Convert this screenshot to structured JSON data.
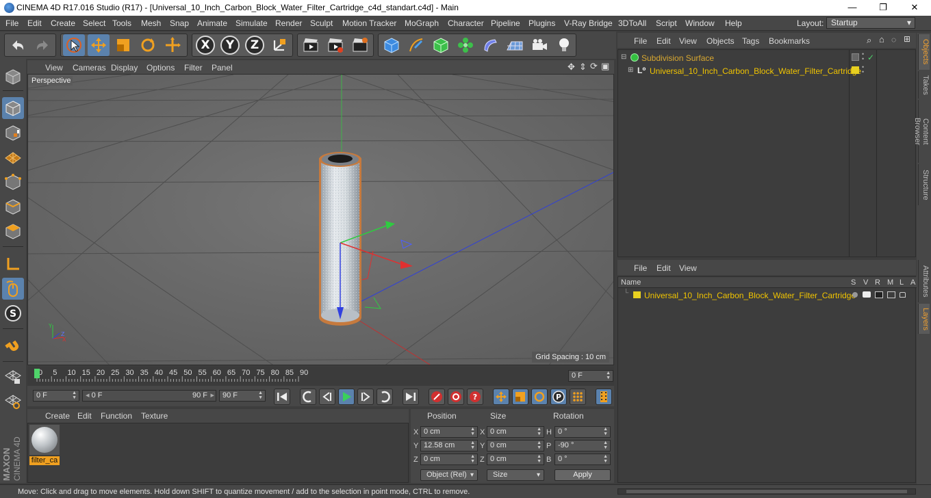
{
  "window": {
    "title": "CINEMA 4D R17.016 Studio (R17) - [Universal_10_Inch_Carbon_Block_Water_Filter_Cartridge_c4d_standart.c4d] - Main"
  },
  "menu": [
    "File",
    "Edit",
    "Create",
    "Select",
    "Tools",
    "Mesh",
    "Snap",
    "Animate",
    "Simulate",
    "Render",
    "Sculpt",
    "Motion Tracker",
    "MoGraph",
    "Character",
    "Pipeline",
    "Plugins",
    "V-Ray Bridge",
    "3DToAll",
    "Script",
    "Window",
    "Help"
  ],
  "layout": {
    "label": "Layout:",
    "value": "Startup"
  },
  "toolbar": {
    "axes": [
      "X",
      "Y",
      "Z"
    ]
  },
  "viewport": {
    "menu": [
      "View",
      "Cameras",
      "Display",
      "Options",
      "Filter",
      "Panel"
    ],
    "label": "Perspective",
    "grid_spacing": "Grid Spacing : 10 cm"
  },
  "timeline": {
    "ticks": [
      "0",
      "5",
      "10",
      "15",
      "20",
      "25",
      "30",
      "35",
      "40",
      "45",
      "50",
      "55",
      "60",
      "65",
      "70",
      "75",
      "80",
      "85",
      "90"
    ],
    "current_frame": "0 F",
    "start": "0 F",
    "range_start": "0 F",
    "range_end": "90 F",
    "end": "90 F"
  },
  "material_manager": {
    "menu": [
      "Create",
      "Edit",
      "Function",
      "Texture"
    ],
    "materials": [
      {
        "name": "filter_ca"
      }
    ]
  },
  "coordinates": {
    "headers": {
      "position": "Position",
      "size": "Size",
      "rotation": "Rotation"
    },
    "rows": [
      {
        "axis": "X",
        "pos": "0 cm",
        "size_axis": "X",
        "size": "0 cm",
        "rot_axis": "H",
        "rot": "0 °"
      },
      {
        "axis": "Y",
        "pos": "12.58 cm",
        "size_axis": "Y",
        "size": "0 cm",
        "rot_axis": "P",
        "rot": "-90 °"
      },
      {
        "axis": "Z",
        "pos": "0 cm",
        "size_axis": "Z",
        "size": "0 cm",
        "rot_axis": "B",
        "rot": "0 °"
      }
    ],
    "mode": "Object (Rel)",
    "size_mode": "Size",
    "apply": "Apply"
  },
  "object_manager": {
    "menu": [
      "File",
      "Edit",
      "View",
      "Objects",
      "Tags",
      "Bookmarks"
    ],
    "objects": [
      {
        "name": "Subdivision Surface",
        "color": "#d9a830"
      },
      {
        "name": "Universal_10_Inch_Carbon_Block_Water_Filter_Cartridge",
        "color": "#f2c500"
      }
    ]
  },
  "layer_manager": {
    "menu": [
      "File",
      "Edit",
      "View"
    ],
    "columns": [
      "Name",
      "S",
      "V",
      "R",
      "M",
      "L",
      "A"
    ],
    "layers": [
      {
        "name": "Universal_10_Inch_Carbon_Block_Water_Filter_Cartridge",
        "color": "#e8d020"
      }
    ]
  },
  "side_tabs": [
    "Objects",
    "Takes",
    "Content Browser",
    "Structure"
  ],
  "side_tabs_lower": [
    "Attributes",
    "Layers"
  ],
  "brand": {
    "maxon": "MAXON",
    "product": "CINEMA 4D"
  },
  "status": "Move: Click and drag to move elements. Hold down SHIFT to quantize movement / add to the selection in point mode, CTRL to remove."
}
